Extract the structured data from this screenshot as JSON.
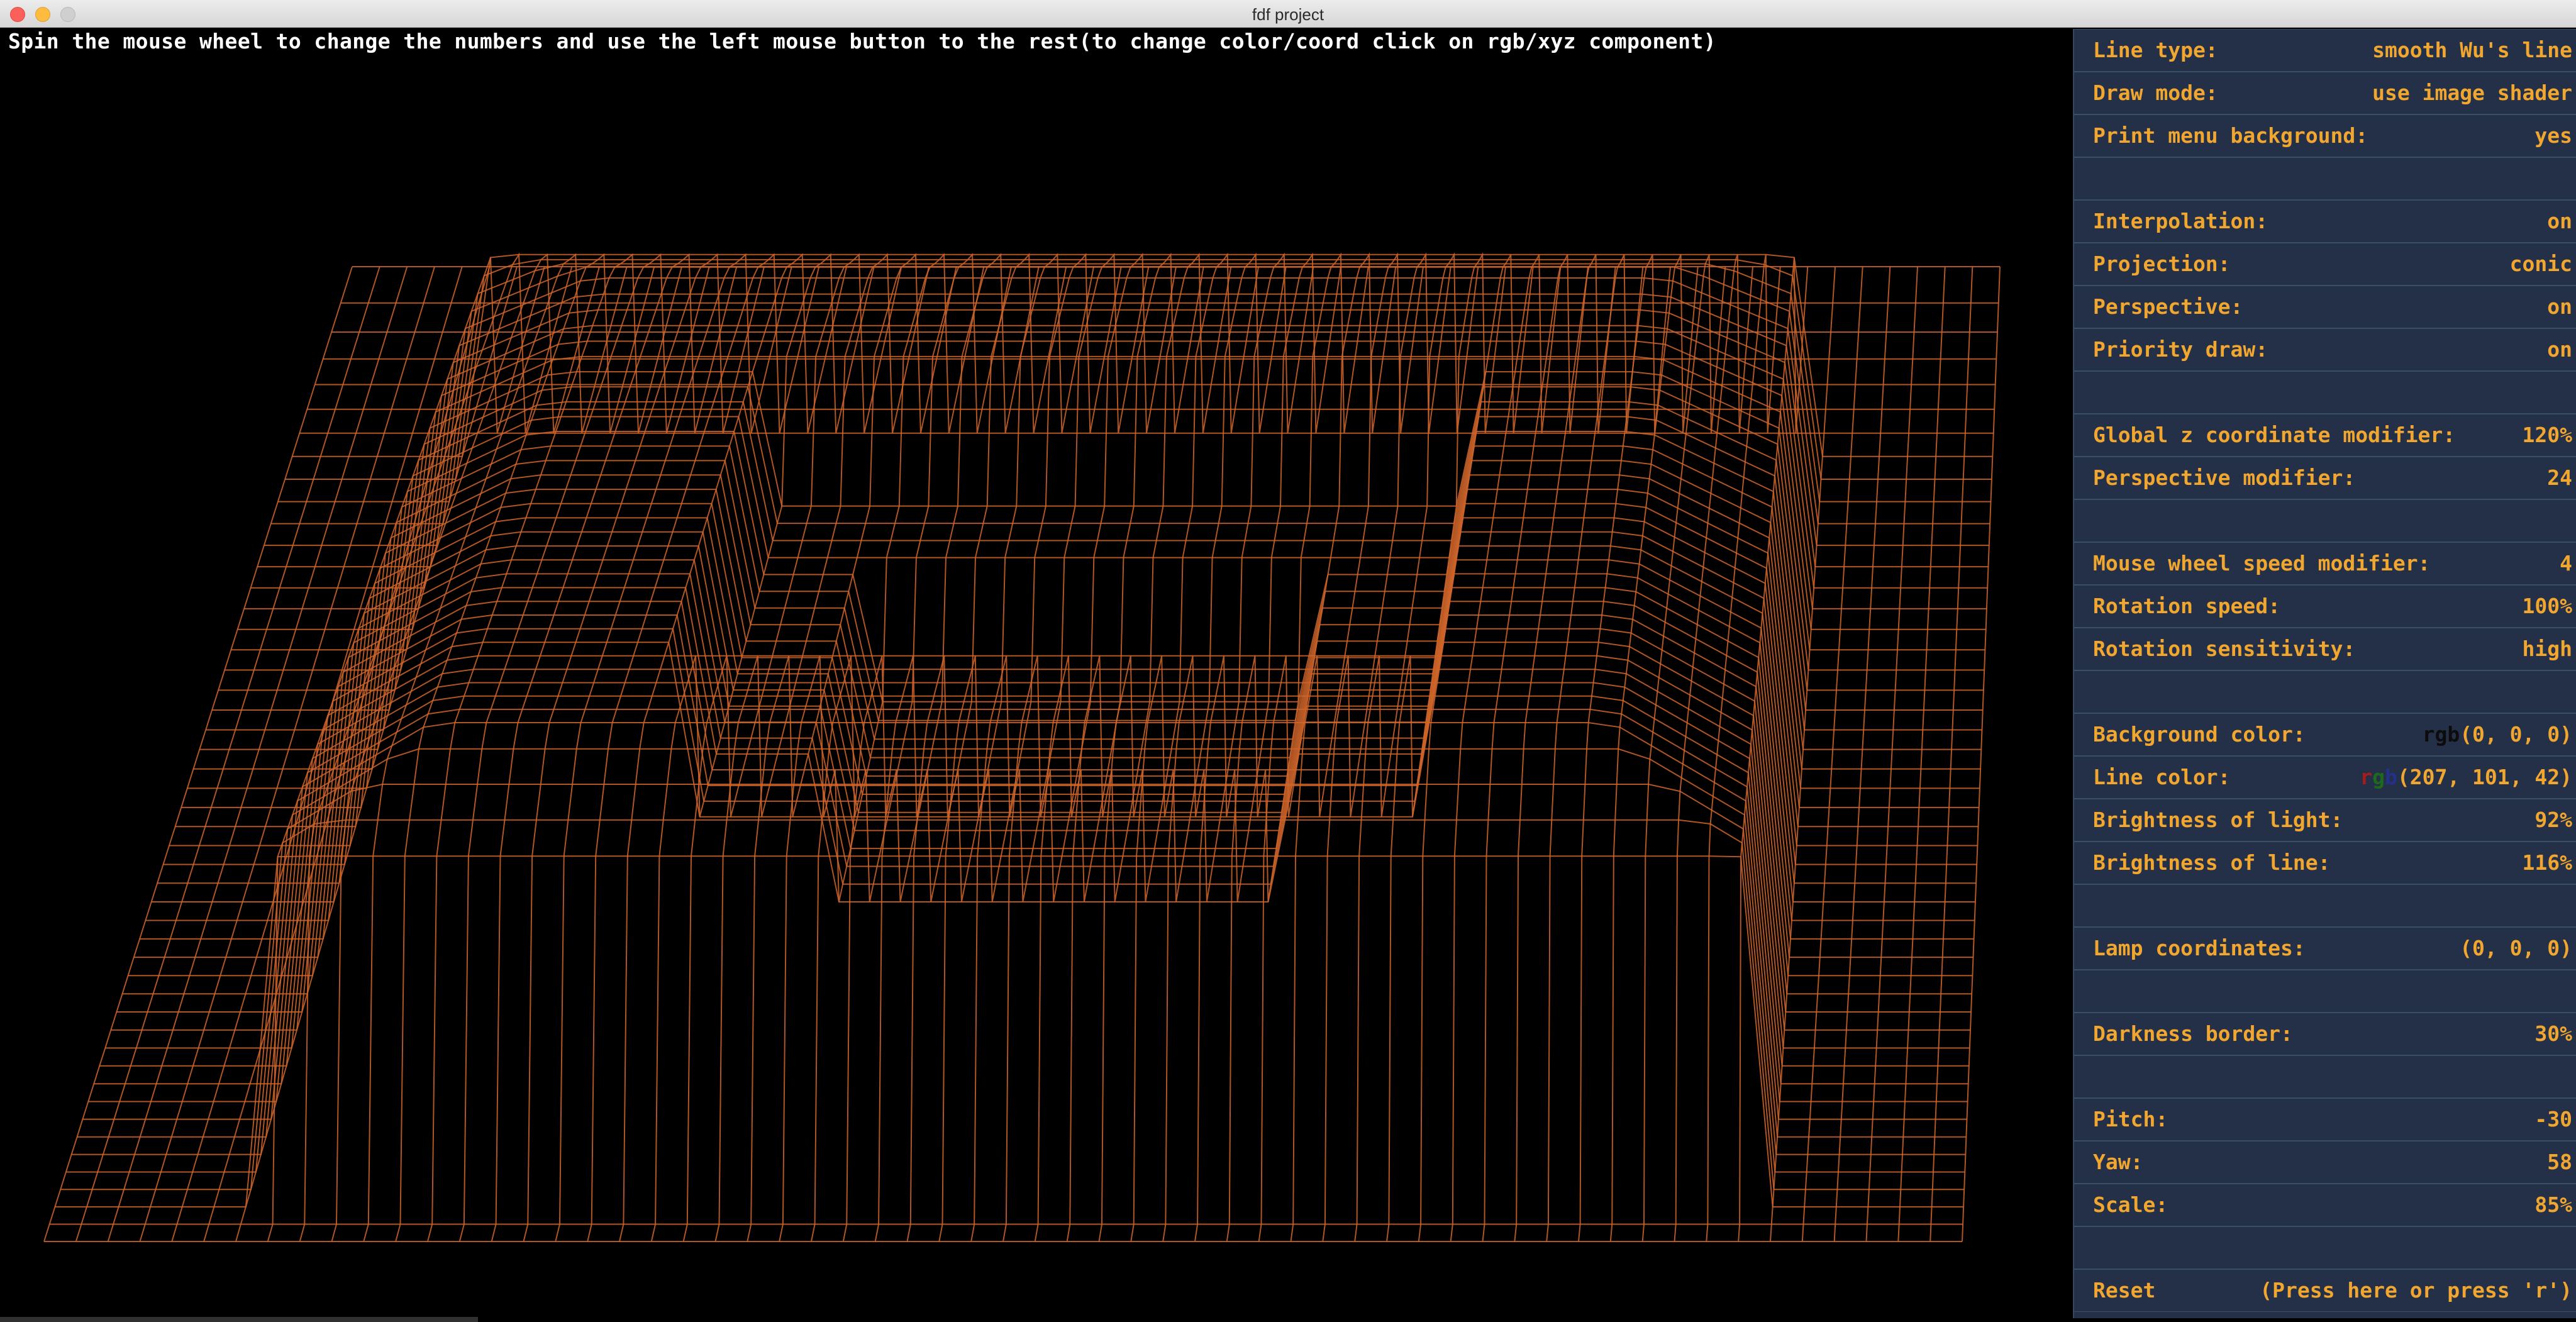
{
  "window": {
    "title": "fdf project"
  },
  "help_text": "Spin the mouse wheel to change the numbers and use the left mouse button to the rest(to change color/coord click on rgb/xyz component)",
  "scene": {
    "background_color": "#000000",
    "line_color": "#cf652a"
  },
  "menu": {
    "rows": [
      {
        "label": "Line type:",
        "value": "smooth Wu's line"
      },
      {
        "label": "Draw mode:",
        "value": "use image shader"
      },
      {
        "label": "Print menu background:",
        "value": "yes"
      },
      {
        "label": "",
        "value": ""
      },
      {
        "label": "Interpolation:",
        "value": "on"
      },
      {
        "label": "Projection:",
        "value": "conic"
      },
      {
        "label": "Perspective:",
        "value": "on"
      },
      {
        "label": "Priority draw:",
        "value": "on"
      },
      {
        "label": "",
        "value": ""
      },
      {
        "label": "Global z coordinate modifier:",
        "value": "120%"
      },
      {
        "label": "Perspective modifier:",
        "value": "24"
      },
      {
        "label": "",
        "value": ""
      },
      {
        "label": "Mouse wheel speed modifier:",
        "value": "4"
      },
      {
        "label": "Rotation speed:",
        "value": "100%"
      },
      {
        "label": "Rotation sensitivity:",
        "value": "high"
      },
      {
        "label": "",
        "value": ""
      },
      {
        "label": "Background color:",
        "value": "rgb(0, 0, 0)"
      },
      {
        "label": "Line color:",
        "value": "rgb(207, 101, 42)"
      },
      {
        "label": "Brightness of light:",
        "value": "92%"
      },
      {
        "label": "Brightness of line:",
        "value": "116%"
      },
      {
        "label": "",
        "value": ""
      },
      {
        "label": "Lamp coordinates:",
        "value": "(0, 0, 0)"
      },
      {
        "label": "",
        "value": ""
      },
      {
        "label": "Darkness border:",
        "value": "30%"
      },
      {
        "label": "",
        "value": ""
      },
      {
        "label": "Pitch:",
        "value": "-30"
      },
      {
        "label": "Yaw:",
        "value": "58"
      },
      {
        "label": "Scale:",
        "value": "85%"
      },
      {
        "label": "",
        "value": ""
      },
      {
        "label": "Reset",
        "value": "(Press here or press 'r')"
      }
    ],
    "background_color": {
      "prefix": "rgb",
      "rest": "(0, 0, 0)"
    },
    "line_color": {
      "r": "r",
      "g": "g",
      "b": "b",
      "rest": "(207, 101, 42)"
    }
  }
}
